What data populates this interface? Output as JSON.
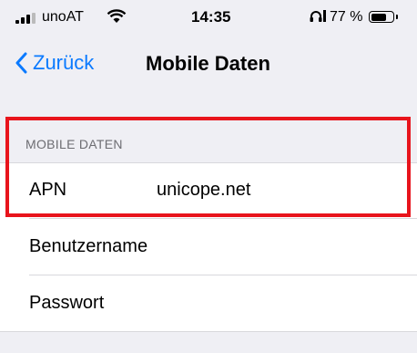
{
  "status_bar": {
    "carrier": "unoAT",
    "time": "14:35",
    "battery_percent": "77 %",
    "battery_level": 0.77,
    "icons": [
      "signal-icon",
      "wifi-icon",
      "headphones-icon",
      "battery-icon"
    ]
  },
  "nav": {
    "back_label": "Zurück",
    "title": "Mobile Daten",
    "accent_color": "#0a7aff"
  },
  "section": {
    "header": "MOBILE DATEN",
    "rows": [
      {
        "label": "APN",
        "value": "unicope.net"
      },
      {
        "label": "Benutzername",
        "value": ""
      },
      {
        "label": "Passwort",
        "value": ""
      }
    ]
  },
  "highlight_color": "#e8141c"
}
